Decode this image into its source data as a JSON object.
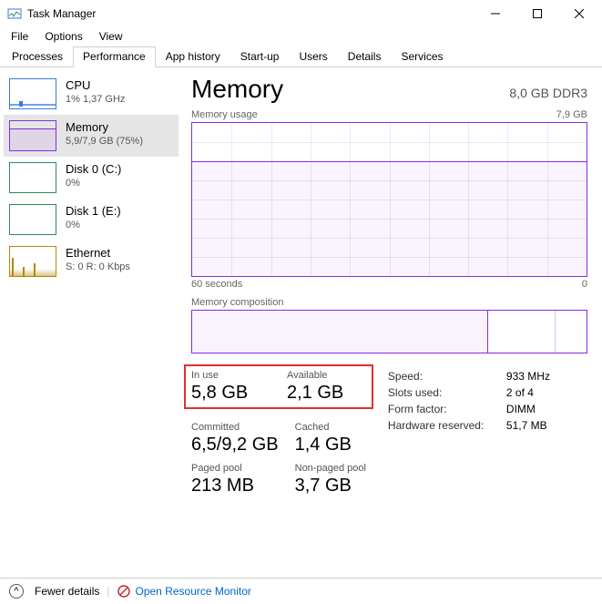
{
  "window": {
    "title": "Task Manager"
  },
  "menu": {
    "file": "File",
    "options": "Options",
    "view": "View"
  },
  "tabs": {
    "processes": "Processes",
    "performance": "Performance",
    "app_history": "App history",
    "startup": "Start-up",
    "users": "Users",
    "details": "Details",
    "services": "Services"
  },
  "sidebar": {
    "cpu": {
      "name": "CPU",
      "val": "1%  1,37 GHz"
    },
    "memory": {
      "name": "Memory",
      "val": "5,9/7,9 GB (75%)"
    },
    "disk0": {
      "name": "Disk 0 (C:)",
      "val": "0%"
    },
    "disk1": {
      "name": "Disk 1 (E:)",
      "val": "0%"
    },
    "eth": {
      "name": "Ethernet",
      "val": "S: 0 R: 0 Kbps"
    }
  },
  "detail": {
    "title": "Memory",
    "capacity": "8,0 GB DDR3",
    "usage_label": "Memory usage",
    "usage_max": "7,9 GB",
    "x_left": "60 seconds",
    "x_right": "0",
    "comp_label": "Memory composition",
    "metrics": {
      "in_use": {
        "label": "In use",
        "val": "5,8 GB"
      },
      "available": {
        "label": "Available",
        "val": "2,1 GB"
      },
      "committed": {
        "label": "Committed",
        "val": "6,5/9,2 GB"
      },
      "cached": {
        "label": "Cached",
        "val": "1,4 GB"
      },
      "paged": {
        "label": "Paged pool",
        "val": "213 MB"
      },
      "nonpaged": {
        "label": "Non-paged pool",
        "val": "3,7 GB"
      }
    },
    "hw": {
      "speed": {
        "label": "Speed:",
        "val": "933 MHz"
      },
      "slots": {
        "label": "Slots used:",
        "val": "2 of 4"
      },
      "ff": {
        "label": "Form factor:",
        "val": "DIMM"
      },
      "hwres": {
        "label": "Hardware reserved:",
        "val": "51,7 MB"
      }
    }
  },
  "footer": {
    "fewer": "Fewer details",
    "orm": "Open Resource Monitor"
  },
  "chart_data": {
    "type": "area",
    "title": "Memory usage",
    "ylabel": "GB",
    "ylim": [
      0,
      7.9
    ],
    "x": [
      "60 seconds",
      "0"
    ],
    "series": [
      {
        "name": "In use",
        "value_gb": 5.9,
        "percent": 75
      }
    ],
    "composition": {
      "in_use_gb": 5.8,
      "available_gb": 2.1,
      "total_gb": 7.9
    }
  }
}
